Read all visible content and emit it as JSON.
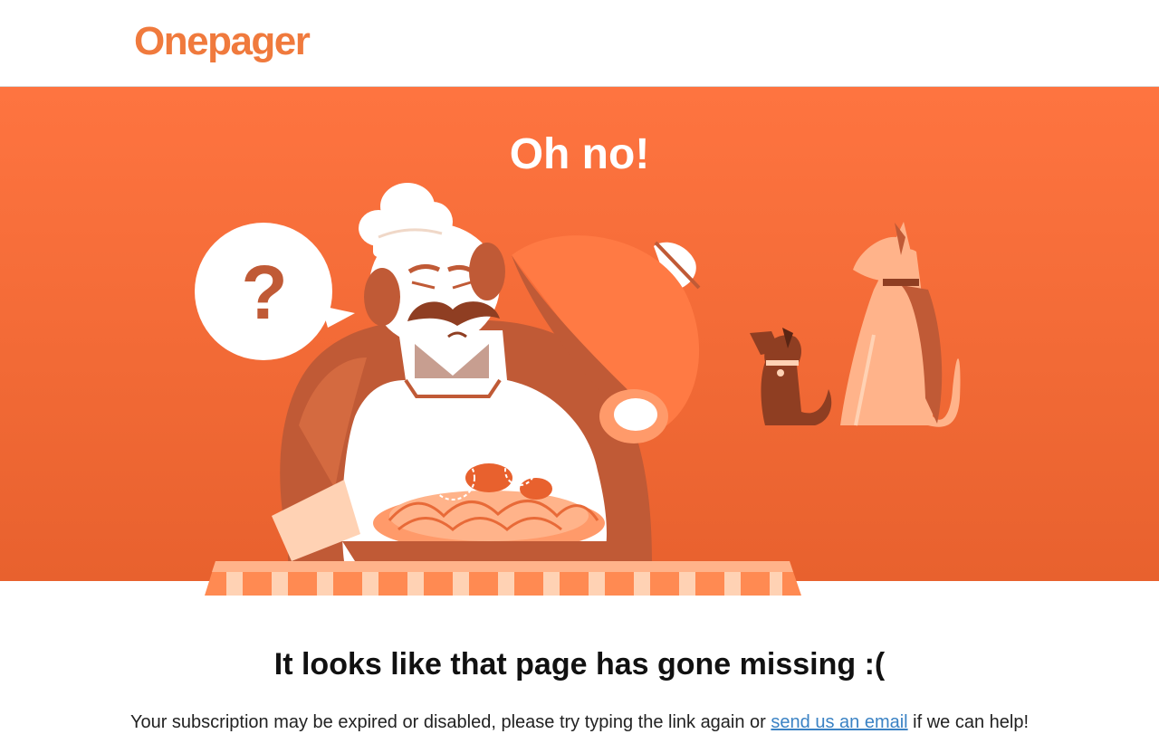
{
  "header": {
    "logo_text": "Onepager"
  },
  "hero": {
    "title": "Oh no!",
    "speech_bubble_text": "?"
  },
  "message": {
    "title": "It looks like that page has gone missing :(",
    "body_before_link": "Your subscription may be expired or disabled, please try typing the link again or ",
    "link_text": "send us an email",
    "body_after_link": " if we can help!"
  },
  "colors": {
    "brand_orange": "#f07a3d",
    "hero_orange": "#fe7440",
    "dark_orange": "#c05a36",
    "light_orange": "#ff9a6a",
    "pale_peach": "#ffd2b4",
    "link_blue": "#3a82c4"
  }
}
